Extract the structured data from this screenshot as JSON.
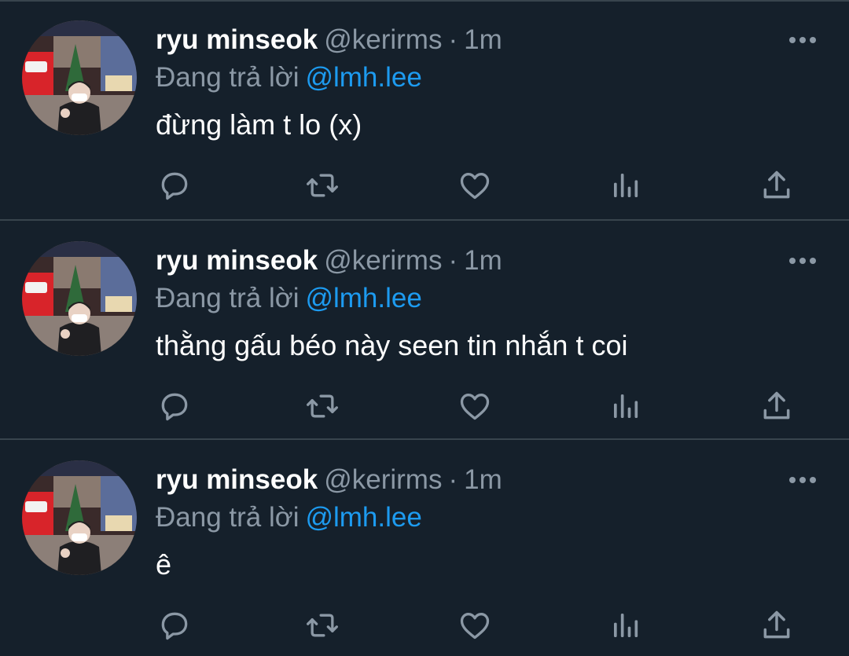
{
  "colors": {
    "background": "#15202b",
    "divider": "#38444d",
    "muted": "#8b98a5",
    "link": "#1d9bf0",
    "text": "#ffffff"
  },
  "icons": {
    "more": "more-dots-icon",
    "reply": "reply-bubble-icon",
    "retweet": "retweet-icon",
    "like": "heart-icon",
    "views": "analytics-bars-icon",
    "share": "share-upload-icon"
  },
  "tweets": [
    {
      "name": "ryu minseok",
      "handle": "@kerirms",
      "separator": "·",
      "time": "1m",
      "reply_prefix": "Đang trả lời",
      "reply_to": "@lmh.lee",
      "text": "đừng làm t lo (x)"
    },
    {
      "name": "ryu minseok",
      "handle": "@kerirms",
      "separator": "·",
      "time": "1m",
      "reply_prefix": "Đang trả lời",
      "reply_to": "@lmh.lee",
      "text": "thằng gấu béo này seen tin nhắn t coi"
    },
    {
      "name": "ryu minseok",
      "handle": "@kerirms",
      "separator": "·",
      "time": "1m",
      "reply_prefix": "Đang trả lời",
      "reply_to": "@lmh.lee",
      "text": "ê"
    }
  ]
}
